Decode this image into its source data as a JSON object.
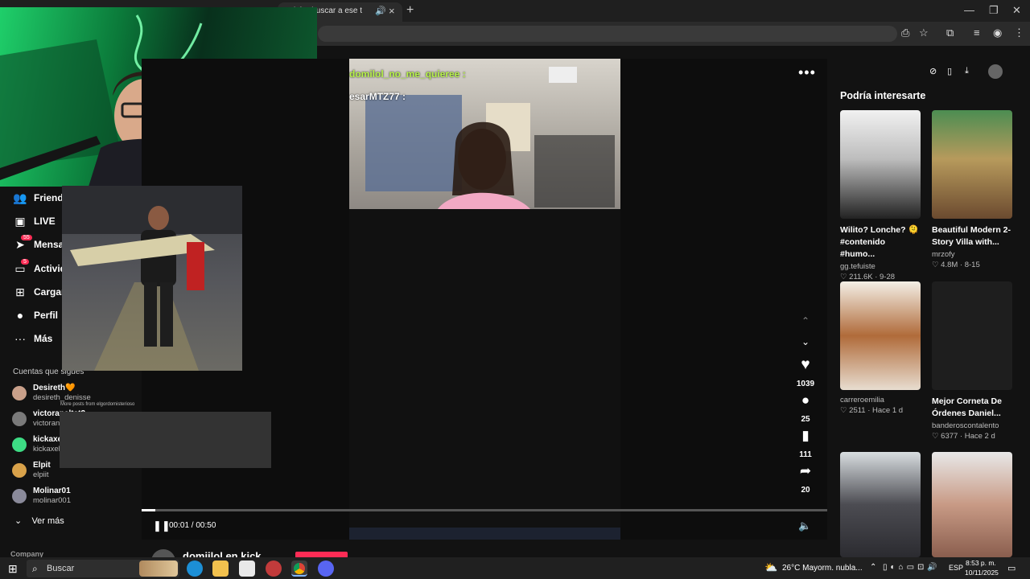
{
  "browser": {
    "active_tab_title": "irá a buscar a ese t",
    "new_tab": "+",
    "minimize": "—",
    "restore": "❐",
    "close": "✕"
  },
  "sidebar": {
    "items": [
      {
        "label": "Friends",
        "icon": "friends-icon"
      },
      {
        "label": "LIVE",
        "icon": "live-icon"
      },
      {
        "label": "Mensajes",
        "icon": "messages-icon",
        "badge": "55"
      },
      {
        "label": "Actividad",
        "icon": "activity-icon",
        "badge": "5"
      },
      {
        "label": "Cargar",
        "icon": "upload-icon"
      },
      {
        "label": "Perfil",
        "icon": "profile-icon"
      },
      {
        "label": "Más",
        "icon": "more-icon"
      }
    ],
    "following_title": "Cuentas que sigues",
    "accounts": [
      {
        "name": "Desireth🧡",
        "handle": "desireth_denisse",
        "color": "#c9a08a"
      },
      {
        "name": "victoraneltat2",
        "handle": "victoraneltat2",
        "color": "#7a7a7a"
      },
      {
        "name": "kickaxelito",
        "handle": "kickaxelito",
        "color": "#3ddc84"
      },
      {
        "name": "Elpit",
        "handle": "elpiit",
        "color": "#d9a24a"
      },
      {
        "name": "Molinar01",
        "handle": "molinar001",
        "color": "#8a8a9a"
      }
    ],
    "see_more": "Ver más",
    "company": "Company"
  },
  "video": {
    "chat_line_1": "domilol_no_me_quieree :",
    "chat_line_2": "esarMTZ77 :",
    "more_posts": "More posts from elgordomisterioso",
    "time": "00:01 / 00:50",
    "progress_fraction": 0.02,
    "channel_name": "domiilol en kick"
  },
  "actions": {
    "likes": "1039",
    "comments": "25",
    "saves": "111",
    "shares": "20"
  },
  "recommendations": {
    "title": "Podría interesarte",
    "cards": [
      {
        "title": "Wilito? Lonche? 🫠 #contenido #humo...",
        "user": "gg.tefuiste",
        "meta": "♡ 211.6K · 9-28"
      },
      {
        "title": "Beautiful Modern 2-Story Villa with...",
        "user": "mrzofy",
        "meta": "♡ 4.8M · 8-15"
      },
      {
        "title": "",
        "user": "carreroemilia",
        "meta": "♡ 2511 · Hace 1 d"
      },
      {
        "title": "Mejor Corneta De Órdenes Daniel...",
        "user": "banderoscontalento",
        "meta": "♡ 6377 · Hace 2 d"
      },
      {
        "title": "",
        "user": "",
        "meta": ""
      },
      {
        "title": "",
        "user": "",
        "meta": ""
      }
    ]
  },
  "taskbar": {
    "search_label": "Buscar",
    "weather": "26°C  Mayorm. nubla...",
    "lang": "ESP",
    "time": "8:53 p. m.",
    "date": "10/11/2025"
  },
  "colors": {
    "accent": "#fe2c55",
    "background": "#121212"
  }
}
